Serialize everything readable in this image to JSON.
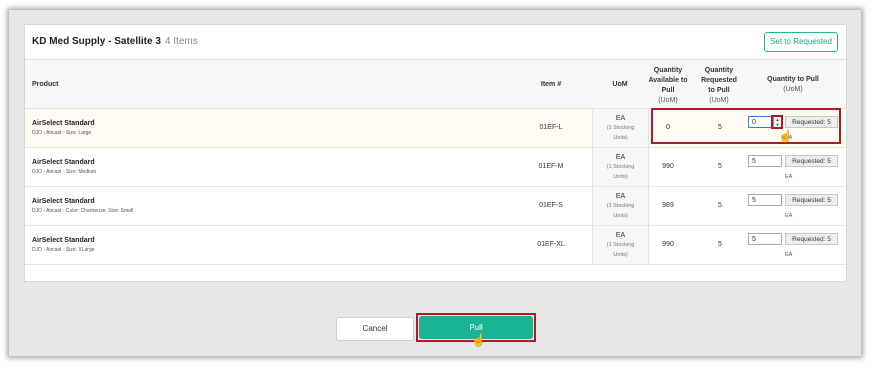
{
  "dialog": {
    "title": "KD Med Supply - Satellite 3",
    "item_count": "4 Items",
    "set_to_requested_label": "Set to Requested"
  },
  "columns": {
    "product": "Product",
    "item": "Item #",
    "uom": "UoM",
    "available_line1": "Quantity",
    "available_line2": "Available to",
    "available_line3": "Pull",
    "available_sub": "(UoM)",
    "requested_line1": "Quantity",
    "requested_line2": "Requested",
    "requested_line3": "to Pull",
    "requested_sub": "(UoM)",
    "to_pull": "Quantity to Pull",
    "to_pull_sub": "(UoM)"
  },
  "rows": [
    {
      "name": "AirSelect Standard",
      "desc": "DJO - Aircast - Size: Large",
      "item": "01EF-L",
      "uom": "EA",
      "uom_detail_1": "(1 Stocking",
      "uom_detail_2": "Units)",
      "available": "0",
      "requested": "5",
      "qty": "0",
      "req_label": "Requested: 5",
      "unit": "EA"
    },
    {
      "name": "AirSelect Standard",
      "desc": "DJO - Aircast - Size: Medium",
      "item": "01EF-M",
      "uom": "EA",
      "uom_detail_1": "(1 Stocking",
      "uom_detail_2": "Units)",
      "available": "990",
      "requested": "5",
      "qty": "5",
      "req_label": "Requested: 5",
      "unit": "EA"
    },
    {
      "name": "AirSelect Standard",
      "desc": "DJO - Aircast - Color: Chartreuse, Size: Small",
      "item": "01EF-S",
      "uom": "EA",
      "uom_detail_1": "(1 Stocking",
      "uom_detail_2": "Units)",
      "available": "989",
      "requested": "5",
      "qty": "5",
      "req_label": "Requested: 5",
      "unit": "EA"
    },
    {
      "name": "AirSelect Standard",
      "desc": "DJO - Aircast - Size: XLarge",
      "item": "01EF-XL",
      "uom": "EA",
      "uom_detail_1": "(1 Stocking",
      "uom_detail_2": "Units)",
      "available": "990",
      "requested": "5",
      "qty": "5",
      "req_label": "Requested: 5",
      "unit": "EA"
    }
  ],
  "footer": {
    "cancel_label": "Cancel",
    "pull_label": "Pull"
  },
  "colors": {
    "accent": "#1ab394",
    "highlight": "#b0192a"
  },
  "icons": {
    "spinner": "number-spinner-icon",
    "cursor": "hand-pointer-icon"
  }
}
